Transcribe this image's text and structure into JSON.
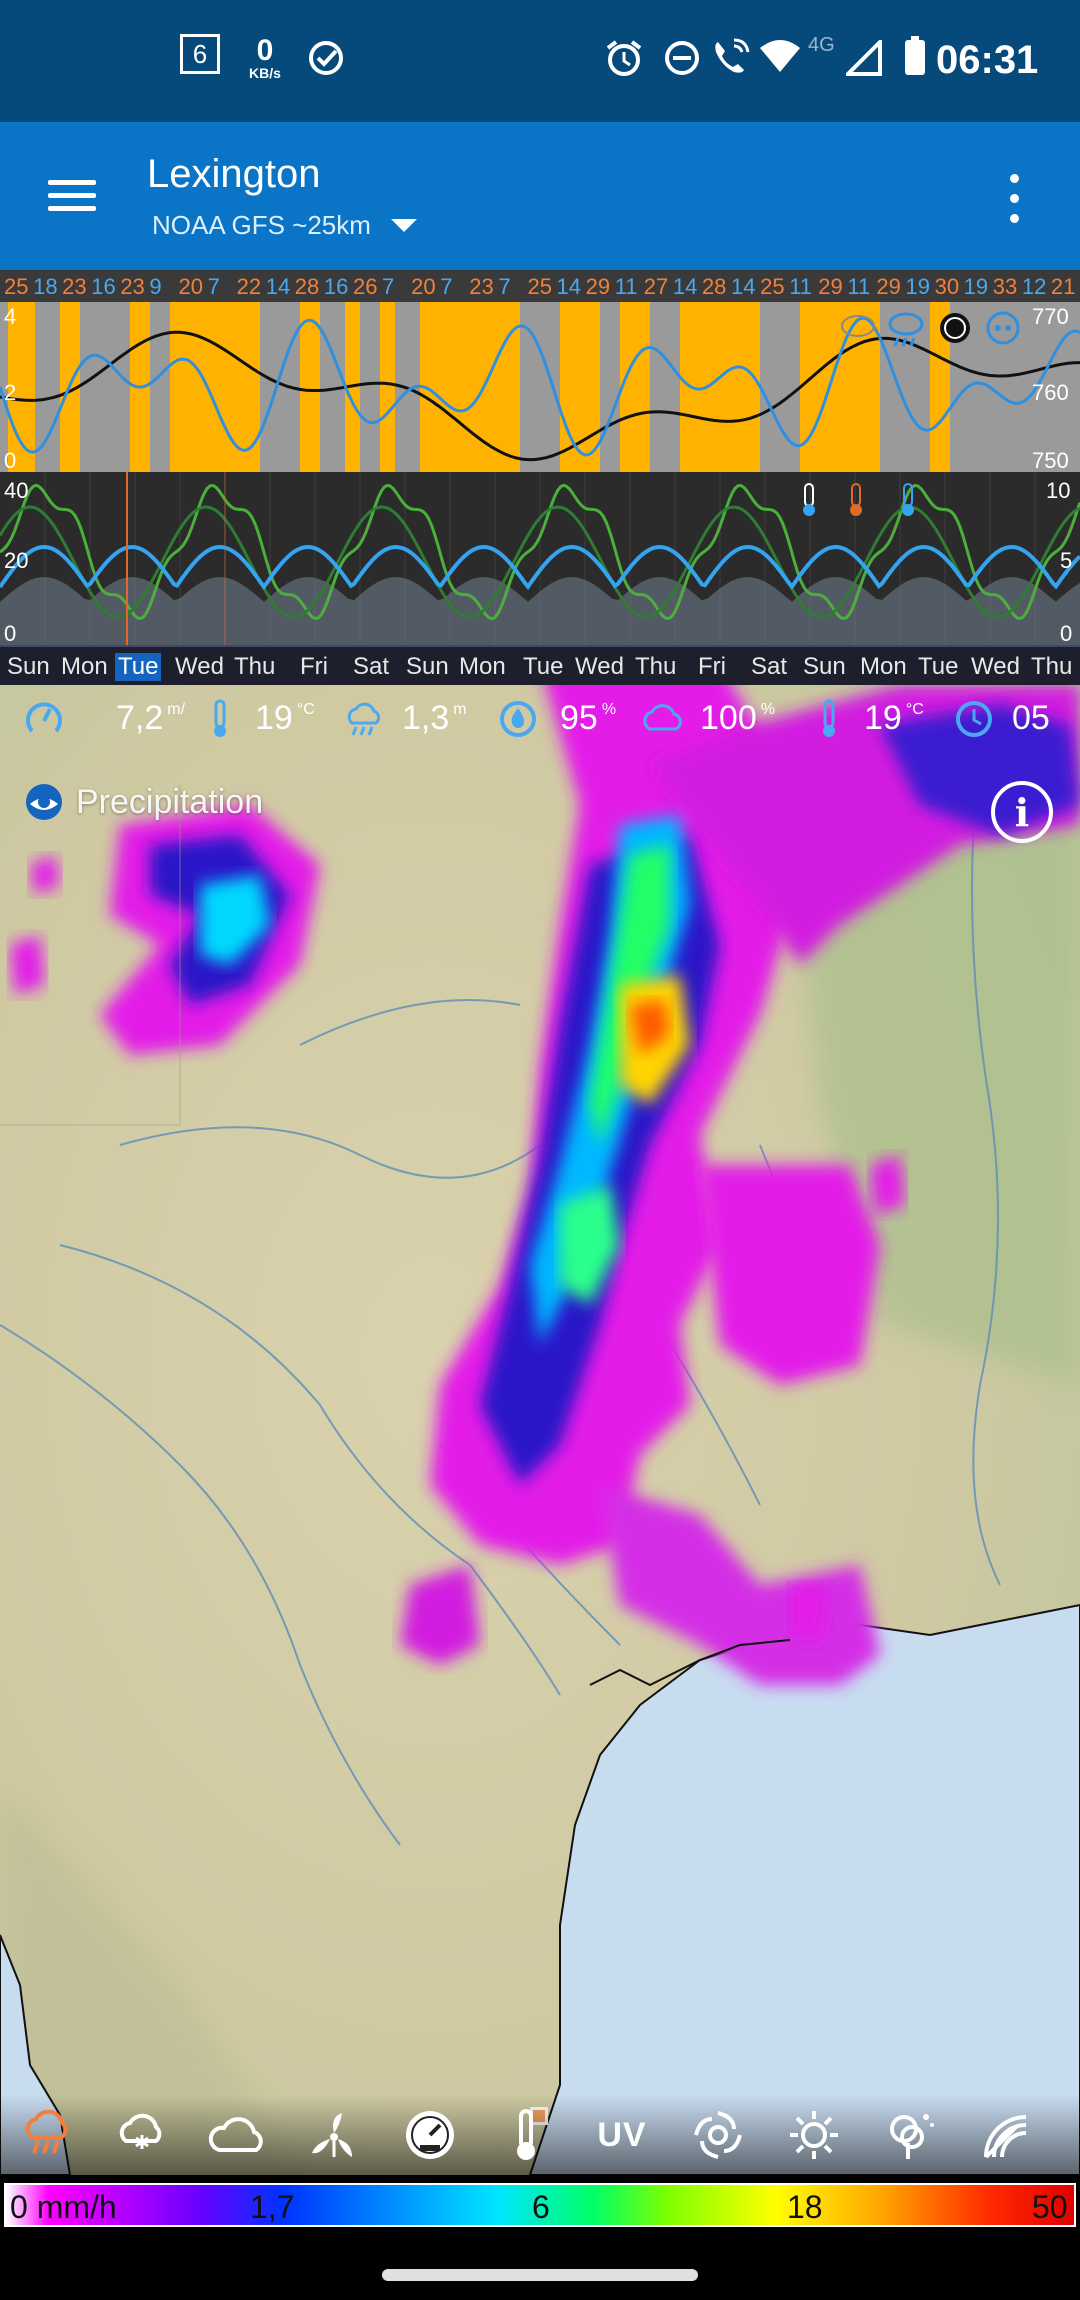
{
  "status_bar": {
    "notification_count": "6",
    "net_speed_value": "0",
    "net_speed_unit": "KB/s",
    "network_type": "4G",
    "time": "06:31"
  },
  "app_bar": {
    "title": "Lexington",
    "model": "NOAA GFS ~25km"
  },
  "forecast": {
    "top_numbers": [
      {
        "v": "25",
        "c": "orange"
      },
      {
        "v": "18",
        "c": "blue"
      },
      {
        "v": "23",
        "c": "orange"
      },
      {
        "v": "16",
        "c": "blue"
      },
      {
        "v": "23",
        "c": "orange"
      },
      {
        "v": "9",
        "c": "blue"
      },
      {
        "v": "20",
        "c": "orange"
      },
      {
        "v": "7",
        "c": "blue"
      },
      {
        "v": "22",
        "c": "orange"
      },
      {
        "v": "14",
        "c": "blue"
      },
      {
        "v": "28",
        "c": "orange"
      },
      {
        "v": "16",
        "c": "blue"
      },
      {
        "v": "26",
        "c": "orange"
      },
      {
        "v": "7",
        "c": "blue"
      },
      {
        "v": "20",
        "c": "orange"
      },
      {
        "v": "7",
        "c": "blue"
      },
      {
        "v": "23",
        "c": "orange"
      },
      {
        "v": "7",
        "c": "blue"
      },
      {
        "v": "25",
        "c": "orange"
      },
      {
        "v": "14",
        "c": "blue"
      },
      {
        "v": "29",
        "c": "orange"
      },
      {
        "v": "11",
        "c": "blue"
      },
      {
        "v": "27",
        "c": "orange"
      },
      {
        "v": "14",
        "c": "blue"
      },
      {
        "v": "28",
        "c": "orange"
      },
      {
        "v": "14",
        "c": "blue"
      },
      {
        "v": "25",
        "c": "orange"
      },
      {
        "v": "11",
        "c": "blue"
      },
      {
        "v": "29",
        "c": "orange"
      },
      {
        "v": "11",
        "c": "blue"
      },
      {
        "v": "29",
        "c": "orange"
      },
      {
        "v": "19",
        "c": "blue"
      },
      {
        "v": "30",
        "c": "orange"
      },
      {
        "v": "19",
        "c": "blue"
      },
      {
        "v": "33",
        "c": "orange"
      },
      {
        "v": "12",
        "c": "blue"
      },
      {
        "v": "21",
        "c": "orange"
      }
    ],
    "upper_axis_left": [
      "4",
      "2",
      "0"
    ],
    "upper_axis_right": [
      "770",
      "760",
      "750"
    ],
    "lower_axis_left": [
      "40",
      "20",
      "0"
    ],
    "lower_axis_right": [
      "10",
      "5",
      "0"
    ],
    "days": [
      "Sun",
      "Mon",
      "Tue",
      "Wed",
      "Thu",
      "Fri",
      "Sat",
      "Sun",
      "Mon",
      "Tue",
      "Wed",
      "Thu",
      "Fri",
      "Sat",
      "Sun",
      "Mon",
      "Tue",
      "Wed",
      "Thu"
    ],
    "selected_day_index": 2
  },
  "metrics": {
    "wind": {
      "value": "7,2",
      "unit": "m/"
    },
    "temp": {
      "value": "19",
      "unit": "°C"
    },
    "precip": {
      "value": "1,3",
      "unit": "m"
    },
    "humidity": {
      "value": "95",
      "unit": "%"
    },
    "cloud": {
      "value": "100",
      "unit": "%"
    },
    "temp2": {
      "value": "19",
      "unit": "°C"
    },
    "time": {
      "value": "05",
      "unit": ""
    }
  },
  "map": {
    "layer_name": "Precipitation",
    "info_label": "i"
  },
  "toolbar": {
    "items": [
      "rain-icon",
      "snow-cloud-icon",
      "cloud-icon",
      "wind-icon",
      "pressure-gauge-icon",
      "thermometer-icon",
      "uv-label",
      "storm-icon",
      "sun-icon",
      "pollen-icon",
      "radar-icon"
    ],
    "uv_label": "UV",
    "active_index": 0
  },
  "legend": {
    "labels": [
      "0 mm/h",
      "1,7",
      "6",
      "18",
      "50"
    ]
  },
  "colors": {
    "status_bar": "#064a7c",
    "app_bar": "#0a74c6",
    "orange": "#f0803c",
    "blue": "#4aa8f0",
    "sunshine": "#ffb300"
  }
}
